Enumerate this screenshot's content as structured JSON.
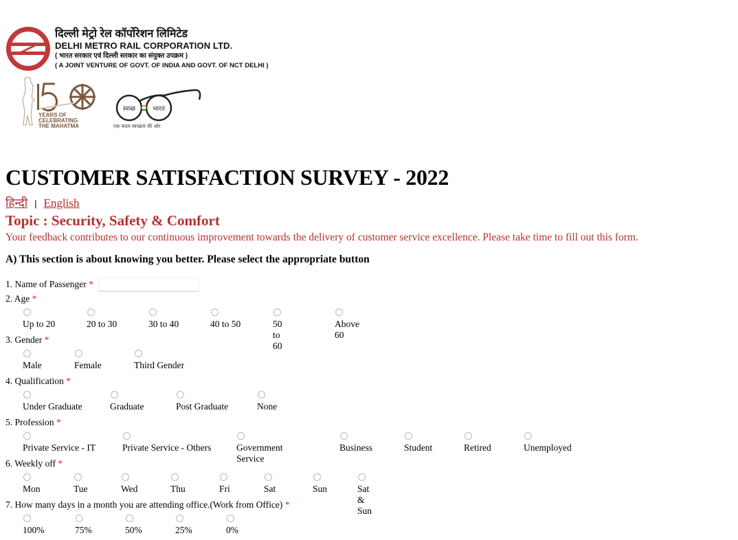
{
  "header": {
    "org_name_hindi": "दिल्ली मेट्रो रेल कॉर्पोरेशन लिमिटेड",
    "org_name_english": "DELHI METRO RAIL CORPORATION LTD.",
    "org_subtitle_hindi": "( भारत सरकार एवं दिल्ली सरकार का संयुक्त उपक्रम )",
    "org_subtitle_english": "( A JOINT VENTURE OF GOVT. OF INDIA AND GOVT. OF NCT DELHI )",
    "logo_icon": "dmrc-logo-icon",
    "brand_color": "#c0393b"
  },
  "badges": {
    "gandhi_150": {
      "number": "150",
      "line1": "YEARS OF",
      "line2": "CELEBRATING",
      "line3": "THE MAHATMA",
      "icon": "gandhi-150-icon",
      "color": "#7a5a3e"
    },
    "swachh_bharat": {
      "left_lens": "स्वच्छ",
      "right_lens": "भारत",
      "tagline": "एक कदम स्वच्छता की ओर",
      "icon": "swachh-bharat-glasses-icon"
    }
  },
  "page": {
    "title": "CUSTOMER SATISFACTION SURVEY - 2022",
    "lang_hindi": "हिन्दी",
    "lang_separator": "|",
    "lang_english": "English",
    "topic": "Topic : Security, Safety & Comfort",
    "intro": "Your feedback contributes to our continuous improvement towards the delivery of customer service excellence. Please take time to fill out this form.",
    "section_a": "A) This section is about knowing you better. Please select the appropriate button",
    "accent_color": "#b53030",
    "required_color": "#e02020"
  },
  "form": {
    "name": {
      "label": "1. Name of Passenger",
      "required": "*",
      "value": "",
      "placeholder": ""
    },
    "questions": [
      {
        "label": "2. Age",
        "required": "*",
        "options": [
          "Up to 20",
          "20 to 30",
          "30 to 40",
          "40 to 50",
          "50 to 60",
          "Above 60"
        ]
      },
      {
        "label": "3. Gender",
        "required": "*",
        "options": [
          "Male",
          "Female",
          "Third Gender"
        ]
      },
      {
        "label": "4. Qualification",
        "required": "*",
        "options": [
          "Under Graduate",
          "Graduate",
          "Post Graduate",
          "None"
        ]
      },
      {
        "label": "5. Profession",
        "required": "*",
        "options": [
          "Private Service - IT",
          "Private Service - Others",
          "Government Service",
          "Business",
          "Student",
          "Retired",
          "Unemployed"
        ]
      },
      {
        "label": "6. Weekly off",
        "required": "*",
        "options": [
          "Mon",
          "Tue",
          "Wed",
          "Thu",
          "Fri",
          "Sat",
          "Sun",
          "Sat & Sun"
        ]
      },
      {
        "label": "7. How many days in a month you are attending office.(Work from Office)",
        "required": "*",
        "options": [
          "100%",
          "75%",
          "50%",
          "25%",
          "0%"
        ]
      }
    ]
  }
}
